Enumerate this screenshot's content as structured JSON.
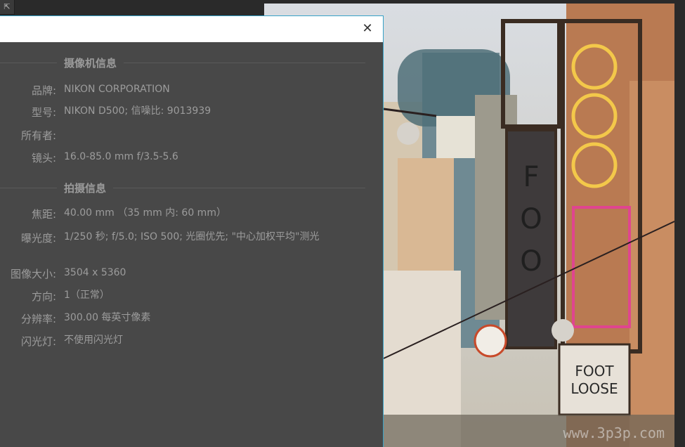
{
  "corner_tool": {
    "icon": "move-icon",
    "glyph": "⇱"
  },
  "dialog": {
    "close_glyph": "✕",
    "sections": [
      {
        "title": "摄像机信息",
        "rows": [
          {
            "label": "品牌:",
            "value": "NIKON CORPORATION"
          },
          {
            "label": "型号:",
            "value": "NIKON  D500;   信噪比: 9013939"
          },
          {
            "label": "所有者:",
            "value": ""
          },
          {
            "label": "镜头:",
            "value": "16.0-85.0 mm f/3.5-5.6"
          }
        ]
      },
      {
        "title": "拍摄信息",
        "rows": [
          {
            "label": "焦距:",
            "value": "40.00 mm    （35 mm 内: 60 mm）"
          },
          {
            "label": "曝光度:",
            "value": "1/250 秒;    f/5.0;    ISO 500;   光圈优先;   \"中心加权平均\"测光"
          },
          {
            "label": "图像大小:",
            "value": "3504 x 5360"
          },
          {
            "label": "方向:",
            "value": "1（正常）"
          },
          {
            "label": "分辨率:",
            "value": "300.00 每英寸像素"
          },
          {
            "label": "闪光灯:",
            "value": "不使用闪光灯"
          }
        ]
      }
    ]
  },
  "photo": {
    "watermark": "www.3p3p.com"
  },
  "colors": {
    "accent": "#36a2c7",
    "dialog_bg": "#484848",
    "text": "#9c9c9c"
  }
}
